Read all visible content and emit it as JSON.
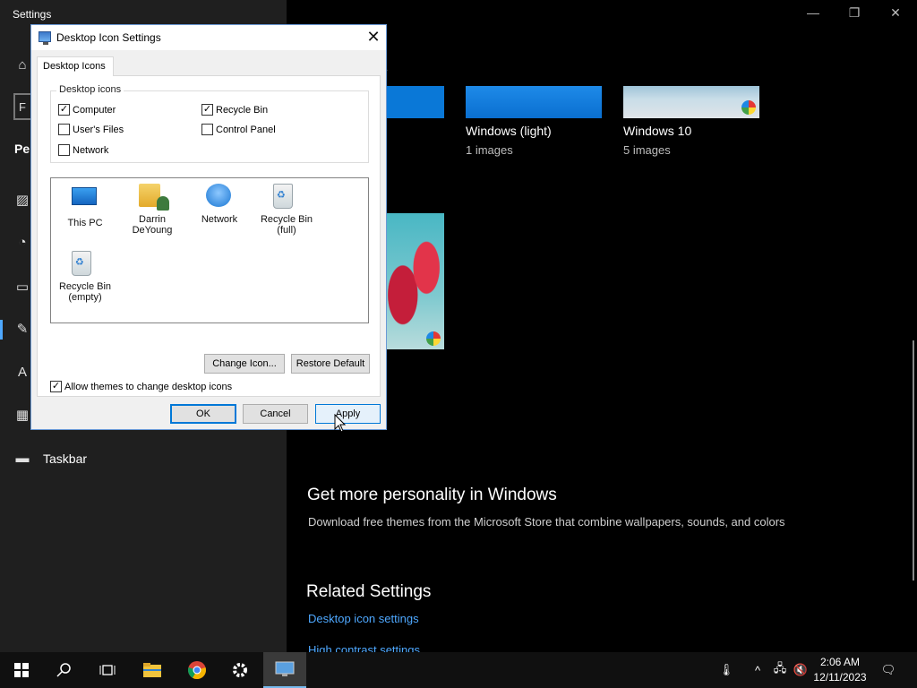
{
  "settings": {
    "title": "Settings",
    "search_stub": "F",
    "section_stub": "Per",
    "nav_taskbar_label": "Taskbar",
    "heading_stub": "s",
    "themes": [
      {
        "name": "Windows (light)",
        "count": "1 images"
      },
      {
        "name": "Windows 10",
        "count": "5 images"
      }
    ],
    "personality_title": "Get more personality in Windows",
    "personality_desc": "Download free themes from the Microsoft Store that combine wallpapers, sounds, and colors",
    "related_title": "Related Settings",
    "desktop_icon_link": "Desktop icon settings",
    "contrast_link": "High contrast settings",
    "accent_color": "#4ea8ff"
  },
  "dialog": {
    "title": "Desktop Icon Settings",
    "tab": "Desktop Icons",
    "group_label": "Desktop icons",
    "checkboxes": [
      {
        "label": "Computer",
        "checked": true
      },
      {
        "label": "Recycle Bin",
        "checked": true
      },
      {
        "label": "User's Files",
        "checked": false
      },
      {
        "label": "Control Panel",
        "checked": false
      },
      {
        "label": "Network",
        "checked": false
      }
    ],
    "icons": [
      {
        "label": "This PC"
      },
      {
        "label": "Darrin DeYoung"
      },
      {
        "label": "Network"
      },
      {
        "label": "Recycle Bin (full)"
      },
      {
        "label": "Recycle Bin (empty)"
      }
    ],
    "change_icon": "Change Icon...",
    "restore_default": "Restore Default",
    "allow_themes": "Allow themes to change desktop icons",
    "allow_themes_checked": true,
    "ok": "OK",
    "cancel": "Cancel",
    "apply": "Apply"
  },
  "taskbar": {
    "time": "2:06 AM",
    "date": "12/11/2023"
  }
}
